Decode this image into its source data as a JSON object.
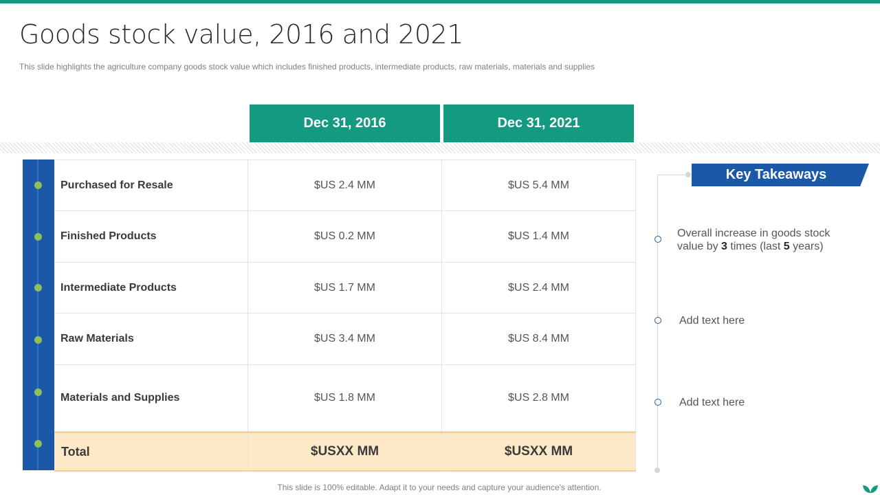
{
  "title": "Goods stock value, 2016 and 2021",
  "subtitle": "This slide highlights the agriculture company goods stock value which includes finished products, intermediate products, raw materials, materials and supplies",
  "columns": [
    "Dec 31, 2016",
    "Dec 31, 2021"
  ],
  "rows": [
    {
      "label": "Purchased for Resale",
      "values": [
        "$US 2.4 MM",
        "$US 5.4 MM"
      ]
    },
    {
      "label": "Finished Products",
      "values": [
        "$US 0.2 MM",
        "$US 1.4 MM"
      ]
    },
    {
      "label": "Intermediate Products",
      "values": [
        "$US 1.7 MM",
        "$US 2.4 MM"
      ]
    },
    {
      "label": "Raw Materials",
      "values": [
        "$US 3.4 MM",
        "$US 8.4 MM"
      ]
    },
    {
      "label": "Materials and Supplies",
      "values": [
        "$US 1.8 MM",
        "$US 2.8 MM"
      ]
    }
  ],
  "total": {
    "label": "Total",
    "values": [
      "$USXX MM",
      "$USXX MM"
    ]
  },
  "takeaways": {
    "heading": "Key Takeaways",
    "item1": {
      "part1": "Overall increase in goods stock value by ",
      "num1": "3",
      "part2": " times (last ",
      "num2": "5",
      "part3": " years)"
    },
    "item2": "Add text here",
    "item3": "Add text here"
  },
  "footer": "This slide is 100% editable. Adapt it to your needs and capture your audience's attention.",
  "colors": {
    "accent_green": "#139a80",
    "accent_blue": "#1c58a8",
    "total_fill": "#fde9c8",
    "dot_green": "#8fbf5a"
  }
}
